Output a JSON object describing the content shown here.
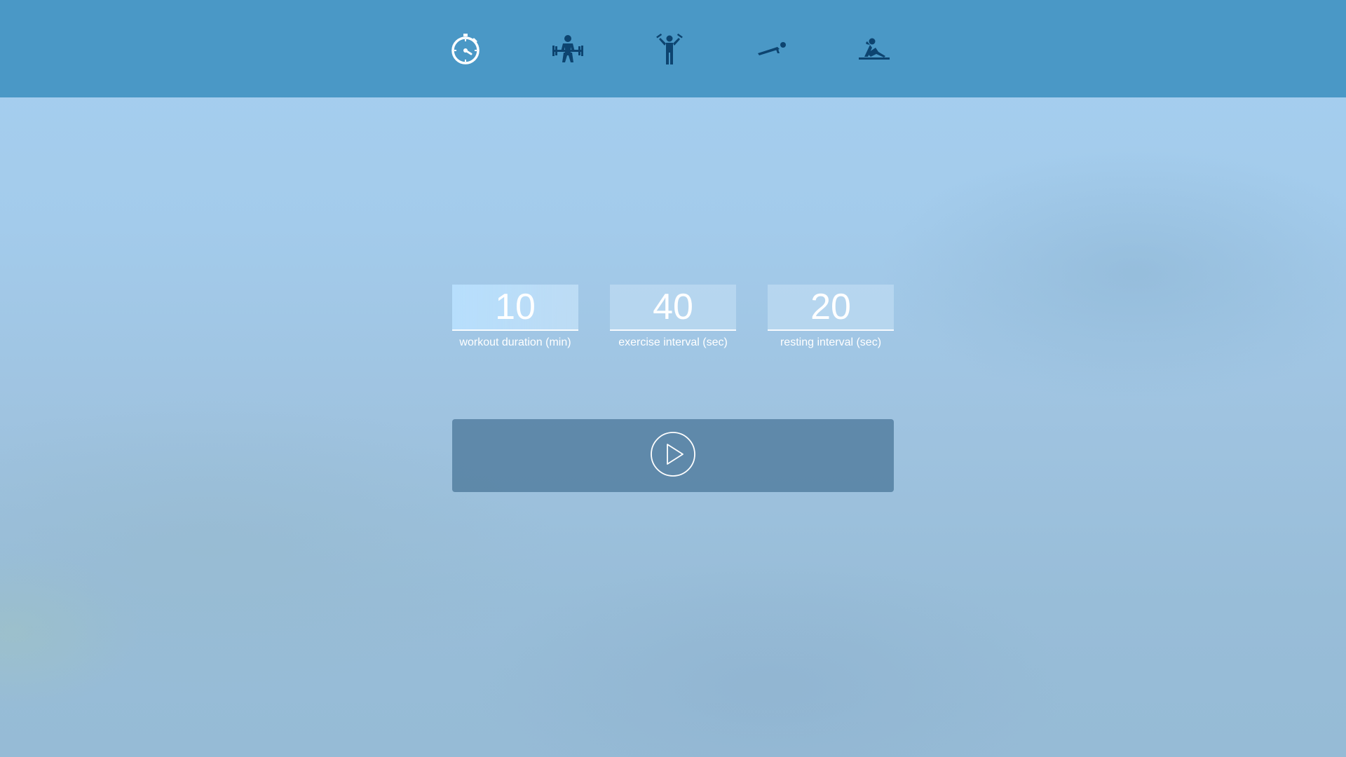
{
  "colors": {
    "topbar": "#4a98c6",
    "nav_icon_active": "#ffffff",
    "nav_icon_inactive": "#0d4470",
    "start_button": "#4e7fa0"
  },
  "nav": {
    "items": [
      {
        "icon": "stopwatch-icon",
        "active": true
      },
      {
        "icon": "weightlifting-icon",
        "active": false
      },
      {
        "icon": "dumbbell-raise-icon",
        "active": false
      },
      {
        "icon": "plank-icon",
        "active": false
      },
      {
        "icon": "situp-icon",
        "active": false
      }
    ]
  },
  "settings": {
    "workout_duration": {
      "value": "10",
      "label": "workout duration (min)"
    },
    "exercise_interval": {
      "value": "40",
      "label": "exercise interval (sec)"
    },
    "resting_interval": {
      "value": "20",
      "label": "resting interval (sec)"
    }
  },
  "start": {
    "icon": "play-icon"
  }
}
